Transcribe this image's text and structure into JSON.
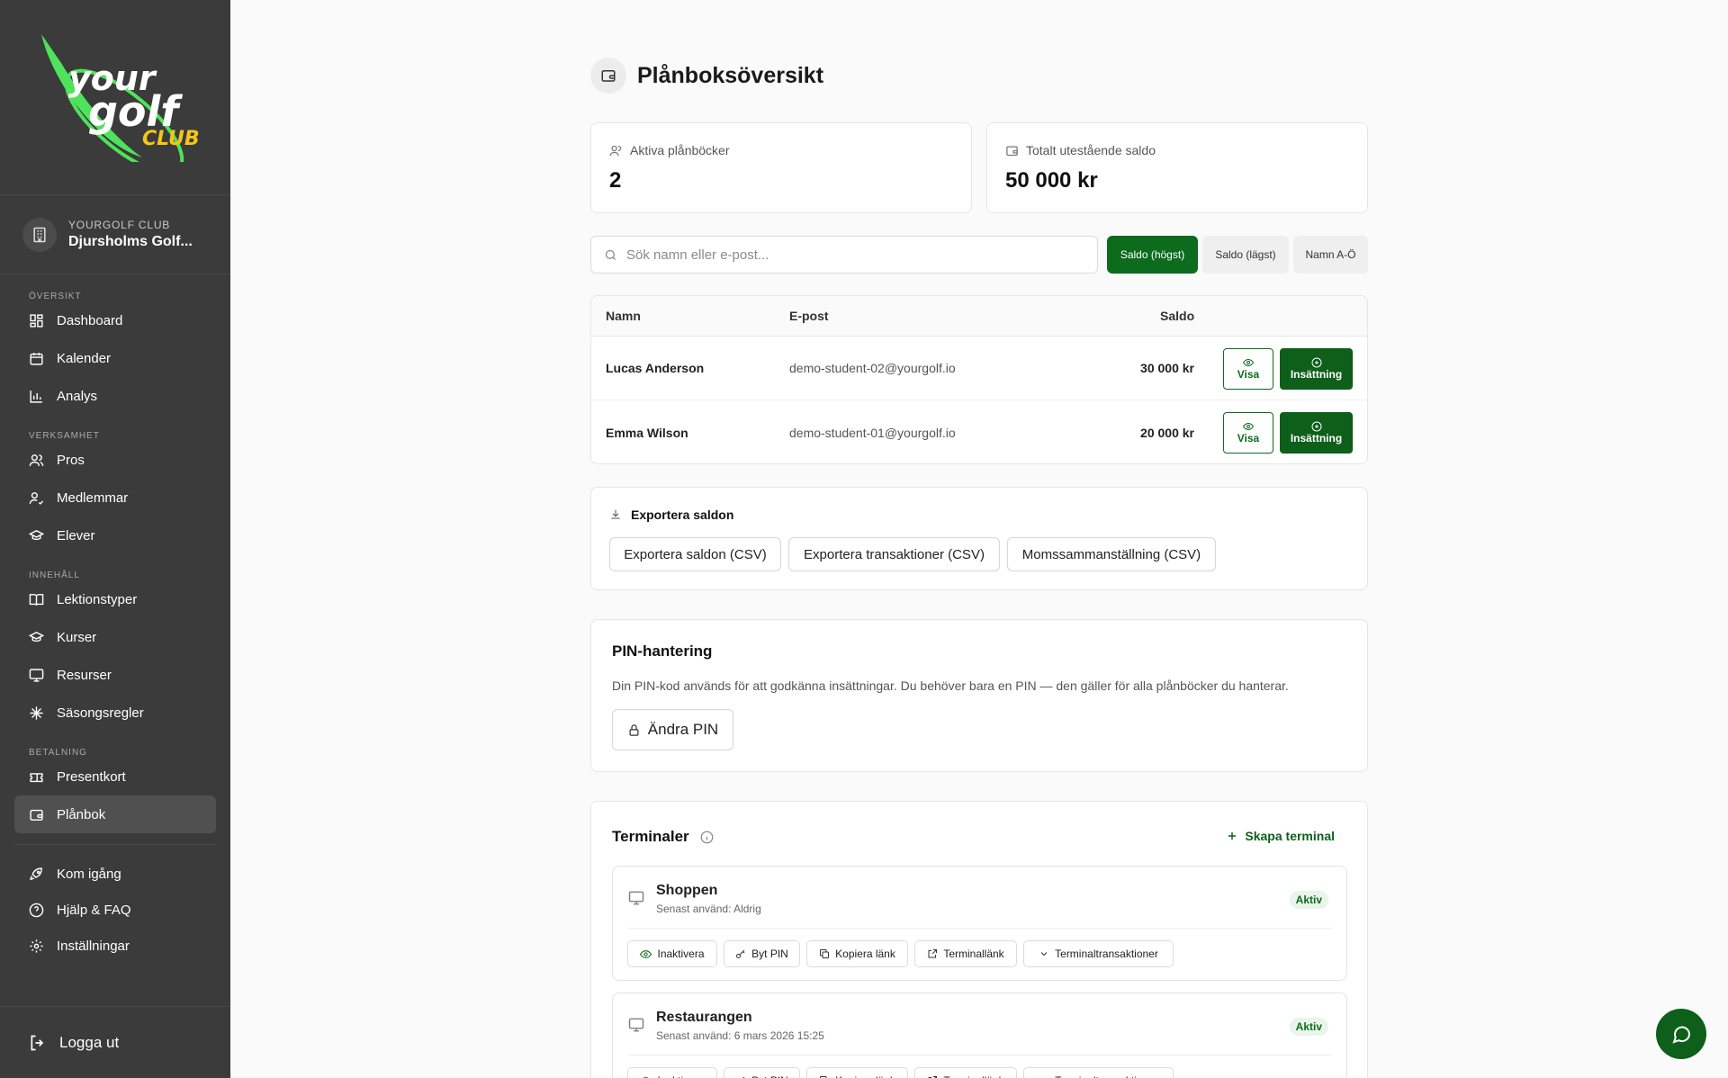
{
  "sidebar": {
    "logo": {
      "word1": "your",
      "word2": "golf",
      "word3": "CLUB"
    },
    "club": {
      "label": "YOURGOLF CLUB",
      "name": "Djursholms Golf..."
    },
    "sections": {
      "overview": "ÖVERSIKT",
      "business": "VERKSAMHET",
      "content": "INNEHÅLL",
      "payment": "BETALNING"
    },
    "items": {
      "dashboard": "Dashboard",
      "calendar": "Kalender",
      "analysis": "Analys",
      "pros": "Pros",
      "members": "Medlemmar",
      "students": "Elever",
      "lesson_types": "Lektionstyper",
      "courses": "Kurser",
      "resources": "Resurser",
      "season_rules": "Säsongsregler",
      "gift_cards": "Presentkort",
      "wallet": "Plånbok",
      "get_started": "Kom igång",
      "help": "Hjälp & FAQ",
      "settings": "Inställningar"
    },
    "logout": "Logga ut"
  },
  "page": {
    "title": "Plånboksöversikt"
  },
  "stats": {
    "active_label": "Aktiva plånböcker",
    "active_value": "2",
    "total_label": "Totalt utestående saldo",
    "total_value": "50 000 kr"
  },
  "search": {
    "placeholder": "Sök namn eller e-post..."
  },
  "sort": {
    "high": "Saldo (högst)",
    "low": "Saldo (lägst)",
    "name": "Namn A-Ö"
  },
  "table": {
    "headers": {
      "name": "Namn",
      "email": "E-post",
      "balance": "Saldo"
    },
    "rows": [
      {
        "name": "Lucas Anderson",
        "email": "demo-student-02@yourgolf.io",
        "balance": "30 000 kr"
      },
      {
        "name": "Emma Wilson",
        "email": "demo-student-01@yourgolf.io",
        "balance": "20 000 kr"
      }
    ],
    "view_label": "Visa",
    "deposit_label": "Insättning"
  },
  "export": {
    "title": "Exportera saldon",
    "balances_csv": "Exportera saldon (CSV)",
    "transactions_csv": "Exportera transaktioner (CSV)",
    "vat_csv": "Momssammanställning (CSV)"
  },
  "pin": {
    "title": "PIN-hantering",
    "description": "Din PIN-kod används för att godkänna insättningar. Du behöver bara en PIN — den gäller för alla plånböcker du hanterar.",
    "change": "Ändra PIN"
  },
  "terminals": {
    "title": "Terminaler",
    "create": "Skapa terminal",
    "items": [
      {
        "name": "Shoppen",
        "last_used": "Senast använd: Aldrig",
        "status": "Aktiv"
      },
      {
        "name": "Restaurangen",
        "last_used": "Senast använd: 6 mars 2026 15:25",
        "status": "Aktiv"
      }
    ],
    "actions": {
      "deactivate": "Inaktivera",
      "change_pin": "Byt PIN",
      "copy_link": "Kopiera länk",
      "terminal_link": "Terminallänk",
      "terminal_transactions": "Terminaltransaktioner"
    }
  },
  "colors": {
    "accent": "#0d6b1e",
    "sidebar": "#3b3b3b",
    "logo_green": "#4ee35a",
    "logo_yellow": "#f5c518"
  }
}
